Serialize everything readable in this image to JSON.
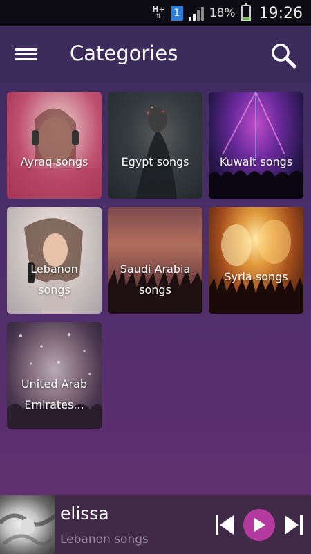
{
  "status_bar": {
    "network_type": "H+",
    "sim_slot": "1",
    "battery_percent": "18%",
    "battery_level": 0.18,
    "time": "19:26"
  },
  "app_bar": {
    "title": "Categories",
    "menu_icon": "hamburger-menu-icon",
    "search_icon": "search-icon"
  },
  "categories": [
    {
      "label": "Ayraq songs"
    },
    {
      "label": "Egypt songs"
    },
    {
      "label": "Kuwait songs"
    },
    {
      "label_lines": [
        "Lebanon",
        "songs"
      ]
    },
    {
      "label_lines": [
        "Saudi Arabia",
        "songs"
      ]
    },
    {
      "label": "Syria songs"
    },
    {
      "label_lines": [
        "United Arab",
        "Emirates..."
      ]
    }
  ],
  "player": {
    "title": "elissa",
    "subtitle": "Lebanon songs",
    "play_button_color": "#b53aa0",
    "icons": [
      "skip-previous-icon",
      "play-icon",
      "skip-next-icon"
    ]
  },
  "colors": {
    "app_bar": "#3c2c5c",
    "player_bar": "#412948",
    "accent": "#b53aa0"
  }
}
